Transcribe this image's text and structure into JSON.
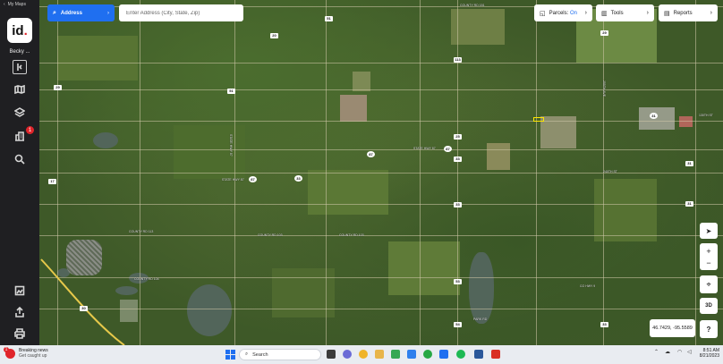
{
  "app": {
    "back_label": "My Maps",
    "logo_text": "id",
    "user_name": "Becky ..."
  },
  "sidebar": {
    "icons": [
      "collapse-icon",
      "map-icon",
      "layers-icon",
      "buildings-icon",
      "location-icon",
      "gallery-icon",
      "share-icon",
      "print-icon"
    ],
    "notification_count": "1"
  },
  "search": {
    "mode_label": "Address",
    "placeholder": "Enter Address (City, State, Zip)"
  },
  "toolbar": {
    "parcels_label": "Parcels:",
    "parcels_state": "On",
    "tools_label": "Tools",
    "reports_label": "Reports"
  },
  "map_controls": {
    "zoom_in": "+",
    "zoom_out": "−",
    "three_d": "3D",
    "help": "?",
    "coordinates": "46.7429, -95.5589"
  },
  "map_labels": {
    "roads": [
      "COUNTY RD 151",
      "STATE HWY 87",
      "STATE HWY 87",
      "COUNTY RD 103",
      "COUNTY RD 103",
      "COUNTY RD 104",
      "240TH ST",
      "130TH ST",
      "COUNTY RD 113",
      "PARK RD",
      "CO HWY 9",
      "STATE HWY 87",
      "255TH AVE"
    ],
    "shields": [
      "29",
      "51",
      "20",
      "113",
      "33",
      "33",
      "17",
      "51",
      "25",
      "87",
      "87",
      "87",
      "31",
      "33",
      "29",
      "53",
      "30",
      "31",
      "33",
      "54",
      "31"
    ]
  },
  "taskbar": {
    "news_title": "Breaking news",
    "news_sub": "Get caught up",
    "news_badge": "1",
    "search_label": "Search",
    "time": "8:51 AM",
    "date": "8/21/2023"
  },
  "colors": {
    "accent": "#1f6ff0",
    "sidebar_bg": "#1f1f22",
    "badge": "#e0252b",
    "parcel_highlight": "#ffe600"
  }
}
